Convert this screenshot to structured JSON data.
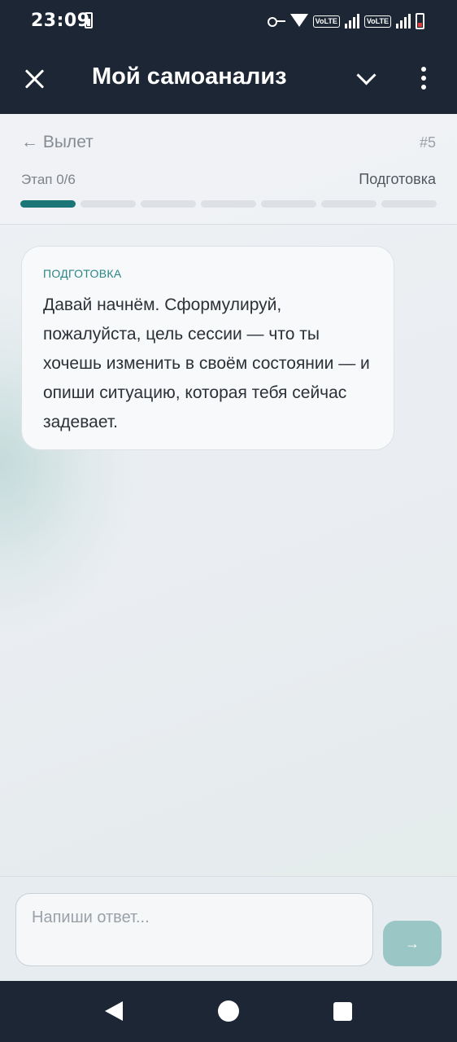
{
  "status_bar": {
    "time": "23:09",
    "volte_1": "VoLTE",
    "volte_2": "VoLTE"
  },
  "app_bar": {
    "title": "Мой самоанализ",
    "close_icon": "close-icon",
    "chevron_icon": "chevron-down-icon",
    "menu_icon": "more-vert-icon"
  },
  "header": {
    "back_link": "← Вылет",
    "session_number": "#5",
    "stage_label": "Этап 0/6",
    "stage_name": "Подготовка",
    "progress": {
      "total_segments": 7,
      "active_segments": 1,
      "active_color": "#1c7577"
    }
  },
  "message": {
    "tag": "ПОДГОТОВКА",
    "text": "Давай начнём. Сформулируй, пожалуйста, цель сессии — что ты хочешь изменить в своём состоянии — и опиши ситуацию, которая тебя сейчас задевает."
  },
  "input": {
    "placeholder": "Напиши ответ...",
    "value": "",
    "send_label": "→",
    "send_color": "#9ac6c6"
  },
  "nav_bar": {
    "back_icon": "nav-back-icon",
    "home_icon": "nav-home-icon",
    "recents_icon": "nav-recents-icon"
  },
  "colors": {
    "app_bar": "#1c2634",
    "accent": "#1c7577"
  }
}
